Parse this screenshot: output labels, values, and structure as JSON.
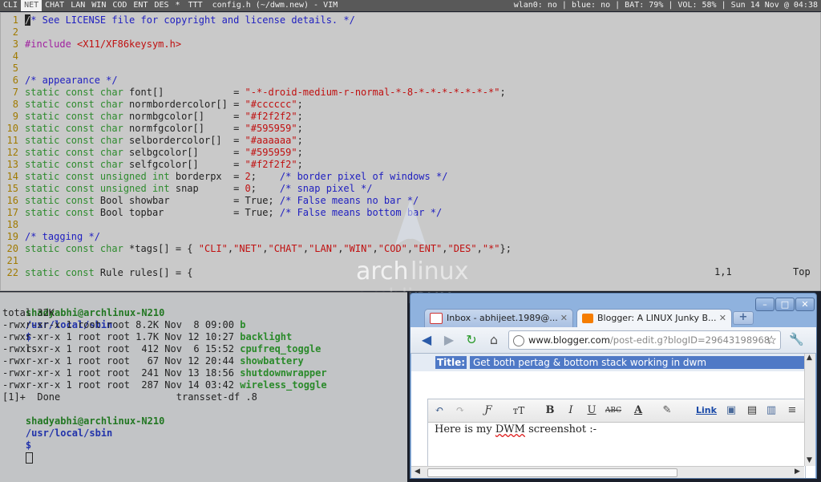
{
  "topbar": {
    "tags": [
      {
        "label": "CLI",
        "selected": false
      },
      {
        "label": "NET",
        "selected": true
      },
      {
        "label": "CHAT",
        "selected": false
      },
      {
        "label": "LAN",
        "selected": false
      },
      {
        "label": "WIN",
        "selected": false
      },
      {
        "label": "COD",
        "selected": false
      },
      {
        "label": "ENT",
        "selected": false
      },
      {
        "label": "DES",
        "selected": false
      },
      {
        "label": "*",
        "selected": false
      }
    ],
    "layout_symbol": "TTT",
    "window_title": "config.h (~/dwm.new) - VIM",
    "status": "wlan0: no | blue: no | BAT: 79% | VOL: 58% | Sun 14 Nov @ 04:38"
  },
  "vim": {
    "lines": [
      {
        "n": "1",
        "segs": [
          [
            "cursor",
            "/"
          ],
          [
            "cmt",
            "* See LICENSE file for copyright and license details. */"
          ]
        ]
      },
      {
        "n": "2",
        "segs": []
      },
      {
        "n": "3",
        "segs": [
          [
            "pre",
            "#include "
          ],
          [
            "str",
            "<X11/XF86keysym.h>"
          ]
        ]
      },
      {
        "n": "4",
        "segs": []
      },
      {
        "n": "5",
        "segs": []
      },
      {
        "n": "6",
        "segs": [
          [
            "cmt",
            "/* appearance */"
          ]
        ]
      },
      {
        "n": "7",
        "segs": [
          [
            "kw",
            "static const char "
          ],
          [
            "normal",
            "font[]            = "
          ],
          [
            "str",
            "\"-*-droid-medium-r-normal-*-8-*-*-*-*-*-*-*\""
          ],
          [
            "normal",
            ";"
          ]
        ]
      },
      {
        "n": "8",
        "segs": [
          [
            "kw",
            "static const char "
          ],
          [
            "normal",
            "normbordercolor[] = "
          ],
          [
            "str",
            "\"#cccccc\""
          ],
          [
            "normal",
            ";"
          ]
        ]
      },
      {
        "n": "9",
        "segs": [
          [
            "kw",
            "static const char "
          ],
          [
            "normal",
            "normbgcolor[]     = "
          ],
          [
            "str",
            "\"#f2f2f2\""
          ],
          [
            "normal",
            ";"
          ]
        ]
      },
      {
        "n": "10",
        "segs": [
          [
            "kw",
            "static const char "
          ],
          [
            "normal",
            "normfgcolor[]     = "
          ],
          [
            "str",
            "\"#595959\""
          ],
          [
            "normal",
            ";"
          ]
        ]
      },
      {
        "n": "11",
        "segs": [
          [
            "kw",
            "static const char "
          ],
          [
            "normal",
            "selbordercolor[]  = "
          ],
          [
            "str",
            "\"#aaaaaa\""
          ],
          [
            "normal",
            ";"
          ]
        ]
      },
      {
        "n": "12",
        "segs": [
          [
            "kw",
            "static const char "
          ],
          [
            "normal",
            "selbgcolor[]      = "
          ],
          [
            "str",
            "\"#595959\""
          ],
          [
            "normal",
            ";"
          ]
        ]
      },
      {
        "n": "13",
        "segs": [
          [
            "kw",
            "static const char "
          ],
          [
            "normal",
            "selfgcolor[]      = "
          ],
          [
            "str",
            "\"#f2f2f2\""
          ],
          [
            "normal",
            ";"
          ]
        ]
      },
      {
        "n": "14",
        "segs": [
          [
            "kw",
            "static const unsigned int "
          ],
          [
            "normal",
            "borderpx  = "
          ],
          [
            "num",
            "2"
          ],
          [
            "normal",
            ";    "
          ],
          [
            "cmt",
            "/* border pixel of windows */"
          ]
        ]
      },
      {
        "n": "15",
        "segs": [
          [
            "kw",
            "static const unsigned int "
          ],
          [
            "normal",
            "snap      = "
          ],
          [
            "num",
            "0"
          ],
          [
            "normal",
            ";    "
          ],
          [
            "cmt",
            "/* snap pixel */"
          ]
        ]
      },
      {
        "n": "16",
        "segs": [
          [
            "kw",
            "static const "
          ],
          [
            "normal",
            "Bool showbar           = True; "
          ],
          [
            "cmt",
            "/* False means no bar */"
          ]
        ]
      },
      {
        "n": "17",
        "segs": [
          [
            "kw",
            "static const "
          ],
          [
            "normal",
            "Bool topbar            = True; "
          ],
          [
            "cmt",
            "/* False means bottom bar */"
          ]
        ]
      },
      {
        "n": "18",
        "segs": []
      },
      {
        "n": "19",
        "segs": [
          [
            "cmt",
            "/* tagging */"
          ]
        ]
      },
      {
        "n": "20",
        "segs": [
          [
            "kw",
            "static const char "
          ],
          [
            "normal",
            "*tags[] = { "
          ],
          [
            "str",
            "\"CLI\""
          ],
          [
            "normal",
            ","
          ],
          [
            "str",
            "\"NET\""
          ],
          [
            "normal",
            ","
          ],
          [
            "str",
            "\"CHAT\""
          ],
          [
            "normal",
            ","
          ],
          [
            "str",
            "\"LAN\""
          ],
          [
            "normal",
            ","
          ],
          [
            "str",
            "\"WIN\""
          ],
          [
            "normal",
            ","
          ],
          [
            "str",
            "\"COD\""
          ],
          [
            "normal",
            ","
          ],
          [
            "str",
            "\"ENT\""
          ],
          [
            "normal",
            ","
          ],
          [
            "str",
            "\"DES\""
          ],
          [
            "normal",
            ","
          ],
          [
            "str",
            "\"*\""
          ],
          [
            "normal",
            "};"
          ]
        ]
      },
      {
        "n": "21",
        "segs": []
      },
      {
        "n": "22",
        "segs": [
          [
            "kw",
            "static const "
          ],
          [
            "normal",
            "Rule rules[] = {"
          ]
        ]
      }
    ],
    "ruler_pos": "1,1",
    "ruler_scroll": "Top"
  },
  "terminal": {
    "prompt_user": "shadyabhi@archlinux-N210",
    "prompt_path": "/usr/local/sbin",
    "prompt_sign": "$",
    "command": "ls",
    "lines": [
      {
        "text": "total 32K",
        "exec": ""
      },
      {
        "text": "-rwxr-xr-x 1 root root 8.2K Nov  8 09:00 ",
        "exec": "b"
      },
      {
        "text": "-rwxr-xr-x 1 root root 1.7K Nov 12 10:27 ",
        "exec": "backlight"
      },
      {
        "text": "-rwxr-xr-x 1 root root  412 Nov  6 15:52 ",
        "exec": "cpufreq_toggle"
      },
      {
        "text": "-rwxr-xr-x 1 root root   67 Nov 12 20:44 ",
        "exec": "showbattery"
      },
      {
        "text": "-rwxr-xr-x 1 root root  241 Nov 13 18:56 ",
        "exec": "shutdownwrapper"
      },
      {
        "text": "-rwxr-xr-x 1 root root  287 Nov 14 03:42 ",
        "exec": "wireless_toggle"
      },
      {
        "text": "[1]+  Done                    transset-df .8",
        "exec": ""
      }
    ]
  },
  "chrome": {
    "tabs": [
      {
        "label": "Inbox - abhijeet.1989@...",
        "icon": "gmail-icon"
      },
      {
        "label": "Blogger: A LINUX Junky B...",
        "icon": "blogger-icon"
      }
    ],
    "url_host": "www.blogger.com",
    "url_rest": "/post-edit.g?blogID=29643198968",
    "post_title_label": "Title:",
    "post_title_value": "Get both pertag & bottom stack working in dwm",
    "toolbar": {
      "undo": "↶",
      "redo": "↷",
      "font": "Ƒ",
      "size": "тT",
      "bold": "B",
      "italic": "I",
      "underline": "U",
      "strike": "ABC",
      "textcolor": "A",
      "link": "Link"
    },
    "post_body": [
      "Here is my ",
      "DWM",
      " screenshot :-"
    ],
    "colors": {
      "accent": "#4f79c6",
      "frame": "#8fb2de"
    }
  }
}
